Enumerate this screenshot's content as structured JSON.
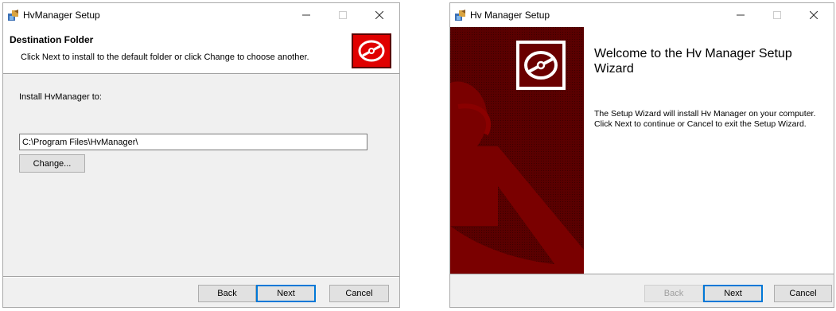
{
  "left_window": {
    "title": "HvManager Setup",
    "header_title": "Destination Folder",
    "header_subtitle": "Click Next to install to the default folder or click Change to choose another.",
    "install_label": "Install HvManager to:",
    "path_value": "C:\\Program Files\\HvManager\\",
    "change_label": "Change...",
    "back_label": "Back",
    "next_label": "Next",
    "cancel_label": "Cancel"
  },
  "right_window": {
    "title": "Hv Manager Setup",
    "welcome_title": "Welcome to the Hv Manager Setup Wizard",
    "welcome_body": "The Setup Wizard will install Hv Manager on your computer. Click Next to continue or Cancel to exit the Setup Wizard.",
    "back_label": "Back",
    "next_label": "Next",
    "cancel_label": "Cancel"
  },
  "titlebar": {
    "minimize_icon": "minimize-icon",
    "maximize_icon": "maximize-icon",
    "close_icon": "close-icon"
  },
  "colors": {
    "dialog_body": "#f0f0f0",
    "banner_red": "#6b0000",
    "logo_red": "#e00000",
    "default_button_border": "#0078d7"
  }
}
